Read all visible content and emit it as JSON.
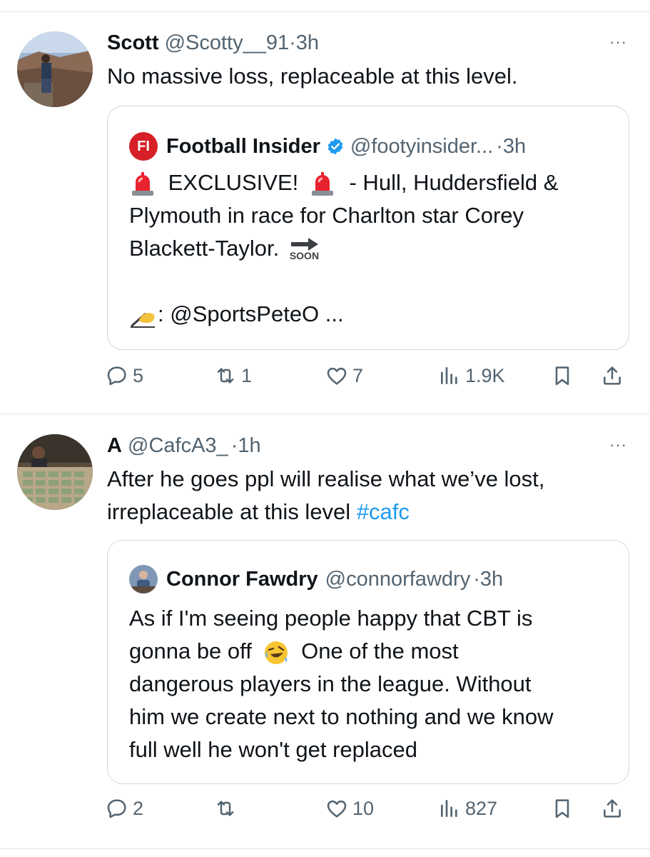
{
  "tweets": [
    {
      "name": "Scott",
      "handle": "@Scotty__91",
      "sep": "·",
      "time": "3h",
      "more": "···",
      "text": "No massive loss, replaceable at this level.",
      "quote": {
        "logo": "FI",
        "name": "Football Insider",
        "handle": "@footyinsider...",
        "sep": "·",
        "time": "3h",
        "line1_part1": "EXCLUSIVE!",
        "line1_part2": "- Hull, Huddersfield &",
        "line2": "Plymouth in race for Charlton star Corey",
        "line3": "Blackett-Taylor.",
        "soon_label": "SOON",
        "line5": ": @SportsPeteO ..."
      },
      "stats": {
        "replies": "5",
        "retweets": "1",
        "likes": "7",
        "views": "1.9K"
      }
    },
    {
      "name": "A",
      "handle": "@CafcA3_",
      "sep": "·",
      "time": "1h",
      "more": "···",
      "text_line1": "After he goes ppl will realise what we’ve lost,",
      "text_line2": "irreplaceable at this level",
      "hashtag": "#cafc",
      "quote": {
        "name": "Connor Fawdry",
        "handle": "@connorfawdry",
        "sep": "·",
        "time": "3h",
        "line1": "As if I'm seeing people happy that CBT is",
        "line2_part1": "gonna be off",
        "line2_part2": "One of the most",
        "line3": "dangerous players in the league. Without",
        "line4": "him we create next to nothing and we know",
        "line5": "full well he won't get replaced"
      },
      "stats": {
        "replies": "2",
        "retweets": "",
        "likes": "10",
        "views": "827"
      }
    }
  ],
  "icons": {
    "reply": "reply-icon",
    "retweet": "retweet-icon",
    "like": "heart-icon",
    "views": "views-icon",
    "bookmark": "bookmark-icon",
    "share": "share-icon",
    "verified": "verified-badge-icon",
    "siren": "siren-emoji",
    "writing": "writing-hand-emoji",
    "laugh": "rolling-laughing-emoji",
    "soon": "soon-arrow-emoji"
  },
  "colors": {
    "link": "#1d9bf0",
    "muted": "#536471",
    "text": "#0f1419",
    "border": "#cfd9de",
    "fi_red": "#d61f26"
  }
}
